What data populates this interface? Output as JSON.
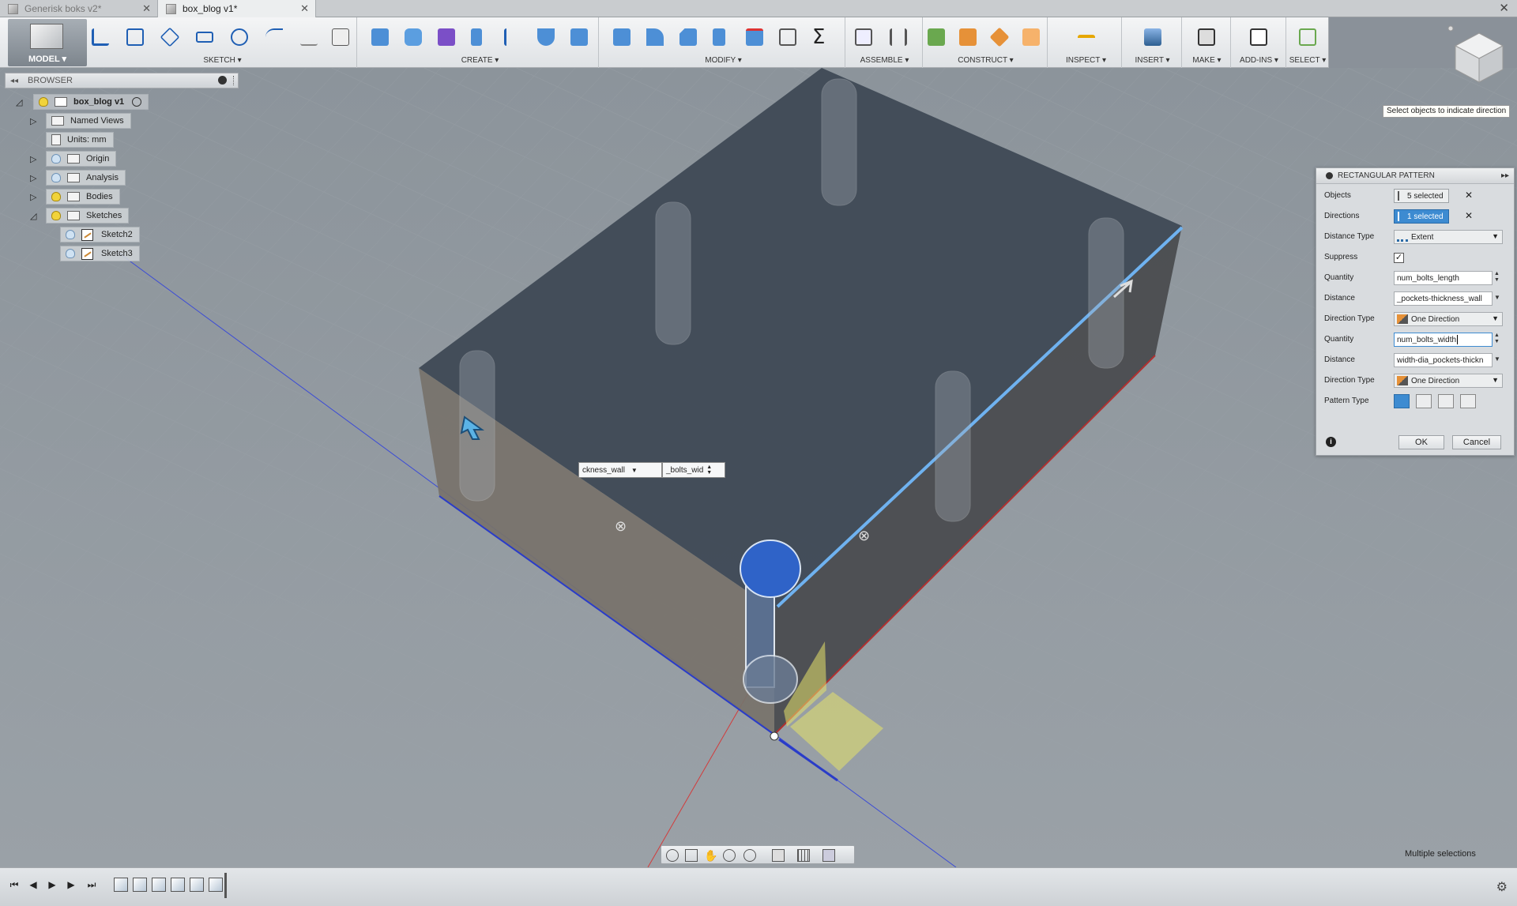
{
  "tabs": [
    {
      "label": "Generisk boks v2*",
      "active": false
    },
    {
      "label": "box_blog v1*",
      "active": true
    }
  ],
  "toolbar": {
    "workspace": "MODEL ▾",
    "groups": [
      {
        "name": "sketch",
        "label": "SKETCH ▾"
      },
      {
        "name": "create",
        "label": "CREATE ▾"
      },
      {
        "name": "modify",
        "label": "MODIFY ▾"
      },
      {
        "name": "assemble",
        "label": "ASSEMBLE ▾"
      },
      {
        "name": "construct",
        "label": "CONSTRUCT ▾"
      },
      {
        "name": "inspect",
        "label": "INSPECT ▾"
      },
      {
        "name": "insert",
        "label": "INSERT ▾"
      },
      {
        "name": "make",
        "label": "MAKE ▾"
      },
      {
        "name": "addins",
        "label": "ADD-INS ▾"
      },
      {
        "name": "select",
        "label": "SELECT ▾"
      }
    ]
  },
  "browser": {
    "title": "BROWSER",
    "root": "box_blog v1",
    "items": [
      {
        "label": "Named Views"
      },
      {
        "label": "Units: mm"
      },
      {
        "label": "Origin"
      },
      {
        "label": "Analysis"
      },
      {
        "label": "Bodies"
      },
      {
        "label": "Sketches"
      },
      {
        "label": "Sketch2"
      },
      {
        "label": "Sketch3"
      }
    ]
  },
  "tooltip": "Select objects to indicate direction",
  "dialog": {
    "title": "RECTANGULAR PATTERN",
    "objects_label": "Objects",
    "objects_value": "5 selected",
    "directions_label": "Directions",
    "directions_value": "1 selected",
    "distance_type_label": "Distance Type",
    "distance_type_value": "Extent",
    "suppress_label": "Suppress",
    "suppress_checked": true,
    "quantity1_label": "Quantity",
    "quantity1_value": "num_bolts_length",
    "distance1_label": "Distance",
    "distance1_value": "_pockets-thickness_wall",
    "direction_type1_label": "Direction Type",
    "direction_type1_value": "One Direction",
    "quantity2_label": "Quantity",
    "quantity2_value": "num_bolts_width",
    "distance2_label": "Distance",
    "distance2_value": "width-dia_pockets-thickn",
    "direction_type2_label": "Direction Type",
    "direction_type2_value": "One Direction",
    "pattern_type_label": "Pattern Type",
    "ok": "OK",
    "cancel": "Cancel"
  },
  "floating_inputs": {
    "distance": "ckness_wall",
    "quantity": "_bolts_wid"
  },
  "status": {
    "selection": "Multiple selections"
  },
  "colors": {
    "accent": "#3d8bd1",
    "body_top": "#3f4a56",
    "grid_bg": "#8d959d"
  }
}
